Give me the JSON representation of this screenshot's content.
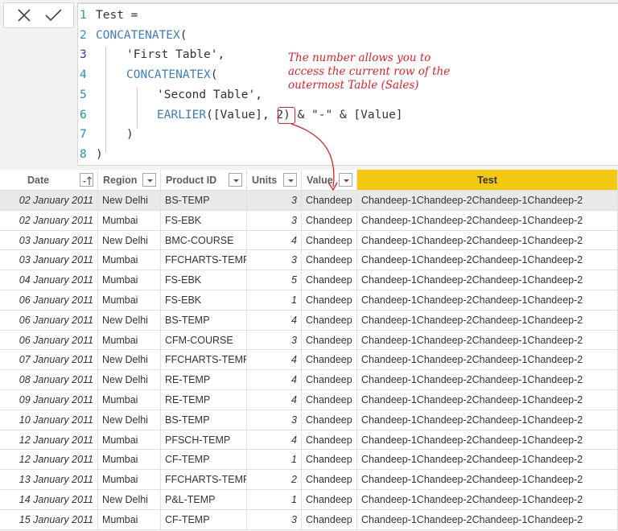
{
  "formula_bar": {
    "cancel_icon": "x-icon",
    "commit_icon": "check-icon",
    "lines": [
      {
        "n": "1",
        "indent": 0,
        "parts": [
          {
            "t": "Test =",
            "kw": false
          }
        ]
      },
      {
        "n": "2",
        "indent": 0,
        "parts": [
          {
            "t": "CONCATENATEX",
            "kw": true
          },
          {
            "t": "(",
            "kw": false
          }
        ]
      },
      {
        "n": "3",
        "indent": 1,
        "parts": [
          {
            "t": "'First Table',",
            "kw": false
          }
        ]
      },
      {
        "n": "4",
        "indent": 1,
        "parts": [
          {
            "t": "CONCATENATEX",
            "kw": true
          },
          {
            "t": "(",
            "kw": false
          }
        ]
      },
      {
        "n": "5",
        "indent": 2,
        "parts": [
          {
            "t": "'Second Table',",
            "kw": false
          }
        ]
      },
      {
        "n": "6",
        "indent": 2,
        "parts": [
          {
            "t": "EARLIER",
            "kw": true
          },
          {
            "t": "([Value], 2) & \"-\" & [Value]",
            "kw": false
          }
        ]
      },
      {
        "n": "7",
        "indent": 1,
        "parts": [
          {
            "t": ")",
            "kw": false
          }
        ]
      },
      {
        "n": "8",
        "indent": 0,
        "parts": [
          {
            "t": ")",
            "kw": false
          }
        ]
      }
    ]
  },
  "annotation": {
    "text": "The number allows you to\naccess the current row of the\noutermost Table (Sales)",
    "color": "#e0202a"
  },
  "table": {
    "columns": [
      {
        "label": "Date",
        "filter_icon": "sort-ascending-icon"
      },
      {
        "label": "Region",
        "filter_icon": "dropdown-icon"
      },
      {
        "label": "Product ID",
        "filter_icon": "dropdown-icon"
      },
      {
        "label": "Units",
        "filter_icon": "dropdown-icon"
      },
      {
        "label": "Value",
        "filter_icon": "dropdown-icon"
      },
      {
        "label": "Test"
      }
    ],
    "highlight_color": "#f2c811",
    "rows": [
      [
        "02 January 2011",
        "New Delhi",
        "BS-TEMP",
        "3",
        "Chandeep",
        "Chandeep-1Chandeep-2Chandeep-1Chandeep-2"
      ],
      [
        "02 January 2011",
        "Mumbai",
        "FS-EBK",
        "3",
        "Chandeep",
        "Chandeep-1Chandeep-2Chandeep-1Chandeep-2"
      ],
      [
        "03 January 2011",
        "New Delhi",
        "BMC-COURSE",
        "4",
        "Chandeep",
        "Chandeep-1Chandeep-2Chandeep-1Chandeep-2"
      ],
      [
        "03 January 2011",
        "Mumbai",
        "FFCHARTS-TEMP",
        "3",
        "Chandeep",
        "Chandeep-1Chandeep-2Chandeep-1Chandeep-2"
      ],
      [
        "04 January 2011",
        "Mumbai",
        "FS-EBK",
        "5",
        "Chandeep",
        "Chandeep-1Chandeep-2Chandeep-1Chandeep-2"
      ],
      [
        "06 January 2011",
        "Mumbai",
        "FS-EBK",
        "1",
        "Chandeep",
        "Chandeep-1Chandeep-2Chandeep-1Chandeep-2"
      ],
      [
        "06 January 2011",
        "New Delhi",
        "BS-TEMP",
        "4",
        "Chandeep",
        "Chandeep-1Chandeep-2Chandeep-1Chandeep-2"
      ],
      [
        "06 January 2011",
        "Mumbai",
        "CFM-COURSE",
        "3",
        "Chandeep",
        "Chandeep-1Chandeep-2Chandeep-1Chandeep-2"
      ],
      [
        "07 January 2011",
        "New Delhi",
        "FFCHARTS-TEMP",
        "4",
        "Chandeep",
        "Chandeep-1Chandeep-2Chandeep-1Chandeep-2"
      ],
      [
        "08 January 2011",
        "New Delhi",
        "RE-TEMP",
        "4",
        "Chandeep",
        "Chandeep-1Chandeep-2Chandeep-1Chandeep-2"
      ],
      [
        "09 January 2011",
        "Mumbai",
        "RE-TEMP",
        "4",
        "Chandeep",
        "Chandeep-1Chandeep-2Chandeep-1Chandeep-2"
      ],
      [
        "10 January 2011",
        "New Delhi",
        "BS-TEMP",
        "3",
        "Chandeep",
        "Chandeep-1Chandeep-2Chandeep-1Chandeep-2"
      ],
      [
        "12 January 2011",
        "Mumbai",
        "PFSCH-TEMP",
        "4",
        "Chandeep",
        "Chandeep-1Chandeep-2Chandeep-1Chandeep-2"
      ],
      [
        "12 January 2011",
        "Mumbai",
        "CF-TEMP",
        "1",
        "Chandeep",
        "Chandeep-1Chandeep-2Chandeep-1Chandeep-2"
      ],
      [
        "13 January 2011",
        "Mumbai",
        "FFCHARTS-TEMP",
        "2",
        "Chandeep",
        "Chandeep-1Chandeep-2Chandeep-1Chandeep-2"
      ],
      [
        "14 January 2011",
        "New Delhi",
        "P&L-TEMP",
        "1",
        "Chandeep",
        "Chandeep-1Chandeep-2Chandeep-1Chandeep-2"
      ],
      [
        "15 January 2011",
        "Mumbai",
        "CF-TEMP",
        "3",
        "Chandeep",
        "Chandeep-1Chandeep-2Chandeep-1Chandeep-2"
      ]
    ]
  }
}
